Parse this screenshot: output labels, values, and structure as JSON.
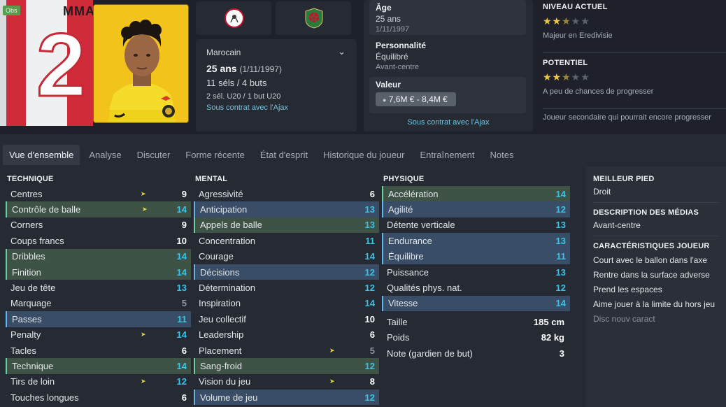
{
  "player": {
    "kit_name": "MMA",
    "kit_number": "2",
    "obs_badge": "Obs",
    "nationality": "Marocain",
    "age": "25 ans",
    "dob_paren": "(1/11/1997)",
    "caps": "11 séls / 4 buts",
    "u20": "2 sél. U20 / 1 but U20",
    "contract": "Sous contrat avec l'Ajax"
  },
  "info": {
    "age_title": "Âge",
    "age_value": "25 ans",
    "age_dob": "1/11/1997",
    "personality_title": "Personnalité",
    "personality_value": "Équilibré",
    "position": "Avant-centre",
    "value_title": "Valeur",
    "value_range": "7,6M € - 8,4M €",
    "contract": "Sous contrat avec l'Ajax"
  },
  "level": {
    "current_title": "NIVEAU ACTUEL",
    "current_stars": 2.5,
    "current_text": "Majeur en Eredivisie",
    "potential_title": "POTENTIEL",
    "potential_stars": 2.5,
    "potential_text": "A peu de chances de progresser",
    "footer_text": "Joueur secondaire qui pourrait encore progresser"
  },
  "tabs": [
    {
      "label": "Vue d'ensemble",
      "active": true
    },
    {
      "label": "Analyse"
    },
    {
      "label": "Discuter"
    },
    {
      "label": "Forme récente"
    },
    {
      "label": "État d'esprit"
    },
    {
      "label": "Historique du joueur"
    },
    {
      "label": "Entraînement"
    },
    {
      "label": "Notes"
    }
  ],
  "technique": {
    "title": "TECHNIQUE",
    "rows": [
      {
        "name": "Centres",
        "value": 9
      },
      {
        "name": "Contrôle de balle",
        "value": 14
      },
      {
        "name": "Corners",
        "value": 9
      },
      {
        "name": "Coups francs",
        "value": 10
      },
      {
        "name": "Dribbles",
        "value": 14
      },
      {
        "name": "Finition",
        "value": 14
      },
      {
        "name": "Jeu de tête",
        "value": 13
      },
      {
        "name": "Marquage",
        "value": 5
      },
      {
        "name": "Passes",
        "value": 11
      },
      {
        "name": "Penalty",
        "value": 14
      },
      {
        "name": "Tacles",
        "value": 6
      },
      {
        "name": "Technique",
        "value": 14
      },
      {
        "name": "Tirs de loin",
        "value": 12
      },
      {
        "name": "Touches longues",
        "value": 6
      }
    ]
  },
  "mental": {
    "title": "MENTAL",
    "rows": [
      {
        "name": "Agressivité",
        "value": 6
      },
      {
        "name": "Anticipation",
        "value": 13
      },
      {
        "name": "Appels de balle",
        "value": 13
      },
      {
        "name": "Concentration",
        "value": 11
      },
      {
        "name": "Courage",
        "value": 14
      },
      {
        "name": "Décisions",
        "value": 12
      },
      {
        "name": "Détermination",
        "value": 12
      },
      {
        "name": "Inspiration",
        "value": 14
      },
      {
        "name": "Jeu collectif",
        "value": 10
      },
      {
        "name": "Leadership",
        "value": 6
      },
      {
        "name": "Placement",
        "value": 5
      },
      {
        "name": "Sang-froid",
        "value": 12
      },
      {
        "name": "Vision du jeu",
        "value": 8
      },
      {
        "name": "Volume de jeu",
        "value": 12
      }
    ]
  },
  "physique": {
    "title": "PHYSIQUE",
    "rows": [
      {
        "name": "Accélération",
        "value": 14
      },
      {
        "name": "Agilité",
        "value": 12
      },
      {
        "name": "Détente verticale",
        "value": 13
      },
      {
        "name": "Endurance",
        "value": 13
      },
      {
        "name": "Équilibre",
        "value": 11
      },
      {
        "name": "Puissance",
        "value": 13
      },
      {
        "name": "Qualités phys. nat.",
        "value": 12
      },
      {
        "name": "Vitesse",
        "value": 14
      }
    ],
    "taille_label": "Taille",
    "taille_value": "185 cm",
    "poids_label": "Poids",
    "poids_value": "82 kg",
    "gk_label": "Note (gardien de but)",
    "gk_value": "3"
  },
  "side": {
    "foot_title": "MEILLEUR PIED",
    "foot_value": "Droit",
    "media_title": "DESCRIPTION DES MÉDIAS",
    "media_value": "Avant-centre",
    "traits_title": "CARACTÉRISTIQUES JOUEUR",
    "traits": [
      "Court avec le ballon dans l'axe",
      "Rentre dans la surface adverse",
      "Prend les espaces",
      "Aime jouer à la limite du hors jeu"
    ],
    "add_trait": "Disc nouv caract"
  },
  "colors": {
    "accent_cyan": "#38c4e8",
    "star_gold": "#f2c744",
    "highlight_green": "#3e5346",
    "highlight_blue": "#3a4d66"
  }
}
